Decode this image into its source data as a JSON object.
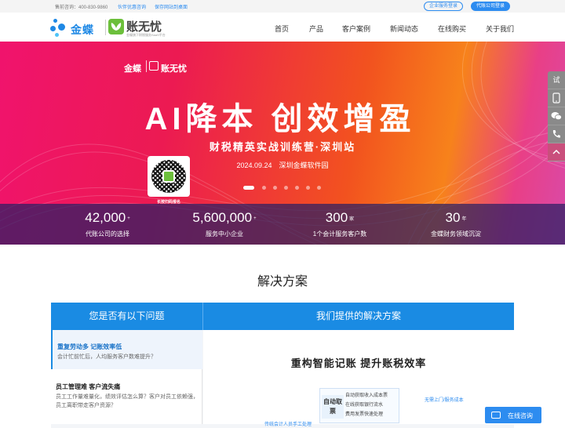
{
  "topbar": {
    "hotline": "售前咨询：400-830-9860",
    "link_experience": "伙伴优惠咨询",
    "link_desktop": "保存网站到桌面",
    "btn_login": "企业服务登录",
    "btn_agent": "代账公司登录"
  },
  "header": {
    "logo_jindie": "金蝶",
    "logo_zwy": "账无忧",
    "logo_slogan": "金蝶旗下财税服务SaaS平台",
    "nav": [
      "首页",
      "产品",
      "客户案例",
      "新闻动态",
      "在线购买",
      "关于我们"
    ]
  },
  "banner": {
    "logo_left": "金蝶",
    "logo_right": "账无忧",
    "headline": "AI降本 创效增盈",
    "subtitle": "财税精英实战训练营·深圳站",
    "date_place": "2024.09.24　深圳金蝶软件园",
    "qr_label": "长按扫码报名",
    "slides": 7,
    "active_slide": 1
  },
  "stats": [
    {
      "number": "42,000",
      "unit": "+",
      "desc": "代账公司的选择"
    },
    {
      "number": "5,600,000",
      "unit": "+",
      "desc": "服务中小企业"
    },
    {
      "number": "300",
      "unit": "家",
      "desc": "1个会计服务客户数"
    },
    {
      "number": "30",
      "unit": "年",
      "desc": "金蝶财务领域沉淀"
    }
  ],
  "sidebar": [
    "试",
    "手机",
    "微信",
    "电话",
    "顶部"
  ],
  "solutions": {
    "title": "解决方案",
    "tab_problems": "您是否有以下问题",
    "tab_solutions": "我们提供的解决方案",
    "problems": [
      {
        "title": "重复劳动多 记账效率低",
        "desc": "会计忙前忙后，人均服务客户数难提升？"
      },
      {
        "title": "员工管理难 客户流失痛",
        "desc": "员工工作量难量化，绩效评估怎么算？客户对员工依赖强，员工离职带走客户资源？"
      }
    ],
    "solution_heading": "重构智能记账  提升账税效率",
    "flow_key": "自动取票",
    "flow_lines": [
      "自动获取收入成本票",
      "在线获取银行流水",
      "费用发票快速处理"
    ],
    "flow_hint": "无需上门/服务成本",
    "flow_hint2": "传统会计人员手工处理"
  },
  "chat": {
    "label": "在线咨询"
  }
}
